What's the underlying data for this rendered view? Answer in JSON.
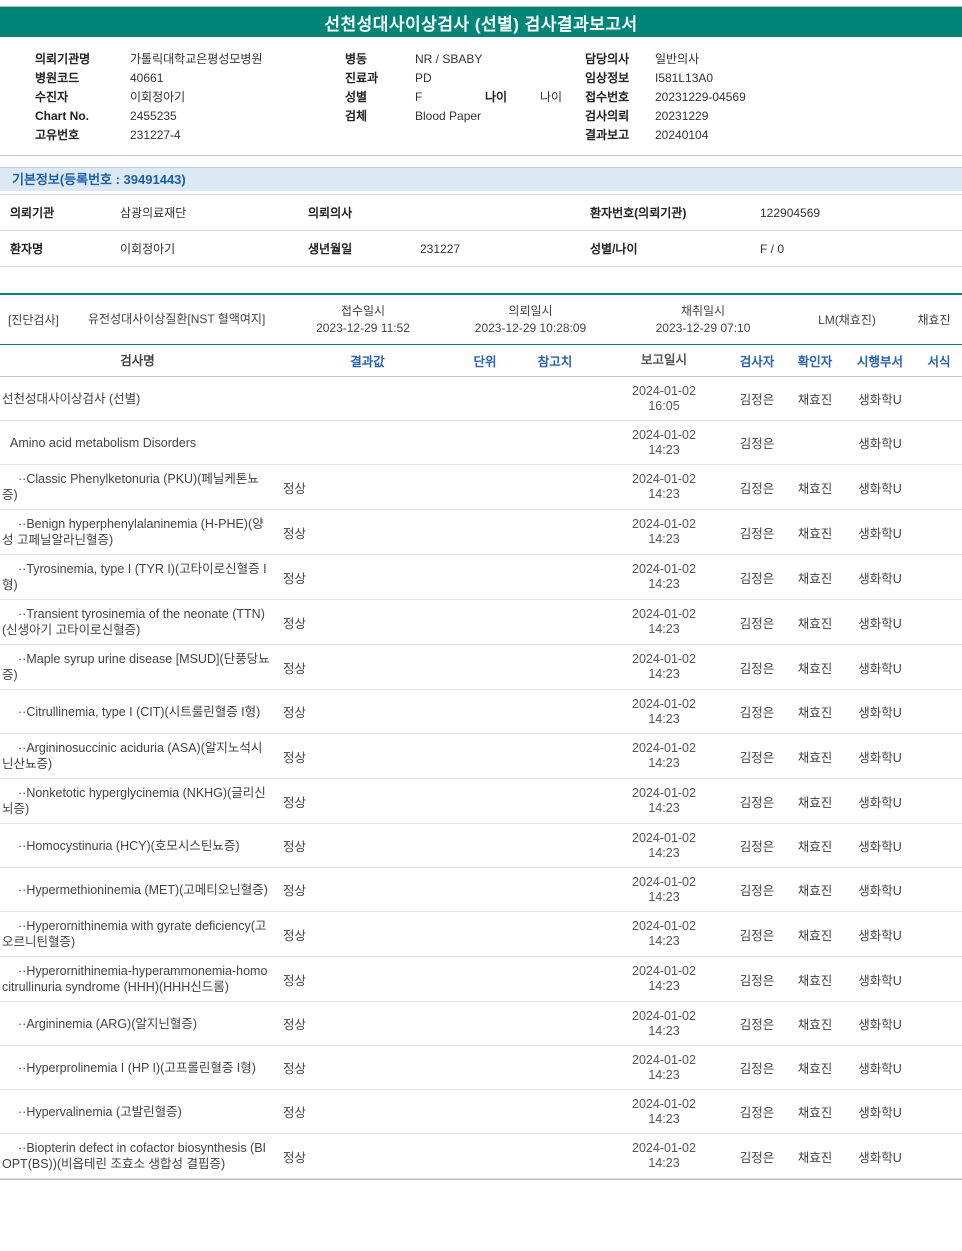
{
  "report": {
    "title": "선천성대사이상검사 (선별) 검사결과보고서"
  },
  "colors": {
    "accent_teal": "#008578",
    "section_bar_bg": "#dce9f5",
    "section_bar_text": "#1d5fa7",
    "table_header_text": "#2a63ae"
  },
  "patient_header": {
    "col1": [
      {
        "label": "의뢰기관명",
        "value": "가톨릭대학교은평성모병원"
      },
      {
        "label": "병원코드",
        "value": "40661"
      },
      {
        "label": "수진자",
        "value": "이회정아기"
      },
      {
        "label": "Chart No.",
        "value": "2455235"
      },
      {
        "label": "고유번호",
        "value": "231227-4"
      }
    ],
    "col2": [
      {
        "label": "병동",
        "value": "NR / SBABY"
      },
      {
        "label": "진료과",
        "value": "PD"
      },
      {
        "label": "성별",
        "value": "F",
        "extra_label": "나이",
        "extra_value": "나이"
      },
      {
        "label": "검체",
        "value": "Blood Paper"
      }
    ],
    "col3": [
      {
        "label": "담당의사",
        "value": "일반의사"
      },
      {
        "label": "임상정보",
        "value": "I581L13A0"
      },
      {
        "label": "접수번호",
        "value": "20231229-04569"
      },
      {
        "label": "검사의뢰",
        "value": "20231229"
      },
      {
        "label": "결과보고",
        "value": "20240104"
      }
    ]
  },
  "basic_info": {
    "title": "기본정보(등록번호 : 39491443)",
    "rows": [
      {
        "cells": [
          {
            "label": "의뢰기관",
            "value": "삼광의료재단"
          },
          {
            "label": "의뢰의사",
            "value": ""
          },
          {
            "label": "환자번호(의뢰기관)",
            "value": "122904569"
          }
        ]
      },
      {
        "cells": [
          {
            "label": "환자명",
            "value": "이회정아기"
          },
          {
            "label": "생년월일",
            "value": "231227"
          },
          {
            "label": "성별/나이",
            "value": "F / 0"
          }
        ]
      }
    ]
  },
  "order_info": {
    "category": "[진단검사]",
    "test_name": "유전성대사이상질환[NST 혈액여지]",
    "fields": [
      {
        "label": "접수일시",
        "value": "2023-12-29 11:52"
      },
      {
        "label": "의뢰일시",
        "value": "2023-12-29 10:28:09"
      },
      {
        "label": "채취일시",
        "value": "2023-12-29 07:10"
      }
    ],
    "collector": "LM(채효진)",
    "collector_name": "채효진"
  },
  "results": {
    "headers": {
      "name": "검사명",
      "result": "결과값",
      "unit": "단위",
      "ref": "참고치",
      "reported": "보고일시",
      "tester": "검사자",
      "confirmer": "확인자",
      "dept": "시행부서",
      "format": "서식"
    },
    "rows": [
      {
        "indent": 0,
        "name": "선천성대사이상검사 (선별)",
        "result": "",
        "unit": "",
        "ref": "",
        "reported": "2024-01-02 16:05",
        "tester": "김정은",
        "confirmer": "채효진",
        "dept": "생화학U"
      },
      {
        "indent": 1,
        "name": "Amino acid metabolism Disorders",
        "result": "",
        "unit": "",
        "ref": "",
        "reported": "2024-01-02 14:23",
        "tester": "김정은",
        "confirmer": "",
        "dept": "생화학U"
      },
      {
        "indent": 2,
        "name": "··Classic Phenylketonuria (PKU)(페닐케톤뇨증)",
        "result": "정상",
        "unit": "",
        "ref": "",
        "reported": "2024-01-02 14:23",
        "tester": "김정은",
        "confirmer": "채효진",
        "dept": "생화학U"
      },
      {
        "indent": 2,
        "name": "··Benign hyperphenylalaninemia (H-PHE)(양성 고페닐알라닌혈증)",
        "result": "정상",
        "unit": "",
        "ref": "",
        "reported": "2024-01-02 14:23",
        "tester": "김정은",
        "confirmer": "채효진",
        "dept": "생화학U"
      },
      {
        "indent": 2,
        "name": "··Tyrosinemia, type I (TYR I)(고타이로신혈증 I형)",
        "result": "정상",
        "unit": "",
        "ref": "",
        "reported": "2024-01-02 14:23",
        "tester": "김정은",
        "confirmer": "채효진",
        "dept": "생화학U"
      },
      {
        "indent": 2,
        "name": "··Transient tyrosinemia of the neonate (TTN)(신생아기 고타이로신혈증)",
        "result": "정상",
        "unit": "",
        "ref": "",
        "reported": "2024-01-02 14:23",
        "tester": "김정은",
        "confirmer": "채효진",
        "dept": "생화학U"
      },
      {
        "indent": 2,
        "name": "··Maple syrup urine disease [MSUD](단풍당뇨증)",
        "result": "정상",
        "unit": "",
        "ref": "",
        "reported": "2024-01-02 14:23",
        "tester": "김정은",
        "confirmer": "채효진",
        "dept": "생화학U"
      },
      {
        "indent": 2,
        "name": "··Citrullinemia, type I (CIT)(시트룰린혈증 I형)",
        "result": "정상",
        "unit": "",
        "ref": "",
        "reported": "2024-01-02 14:23",
        "tester": "김정은",
        "confirmer": "채효진",
        "dept": "생화학U"
      },
      {
        "indent": 2,
        "name": "··Argininosuccinic aciduria (ASA)(알지노석시닌산뇨증)",
        "result": "정상",
        "unit": "",
        "ref": "",
        "reported": "2024-01-02 14:23",
        "tester": "김정은",
        "confirmer": "채효진",
        "dept": "생화학U"
      },
      {
        "indent": 2,
        "name": "··Nonketotic hyperglycinemia (NKHG)(글리신뇌증)",
        "result": "정상",
        "unit": "",
        "ref": "",
        "reported": "2024-01-02 14:23",
        "tester": "김정은",
        "confirmer": "채효진",
        "dept": "생화학U"
      },
      {
        "indent": 2,
        "name": "··Homocystinuria (HCY)(호모시스틴뇨증)",
        "result": "정상",
        "unit": "",
        "ref": "",
        "reported": "2024-01-02 14:23",
        "tester": "김정은",
        "confirmer": "채효진",
        "dept": "생화학U"
      },
      {
        "indent": 2,
        "name": "··Hypermethioninemia (MET)(고메티오닌혈증)",
        "result": "정상",
        "unit": "",
        "ref": "",
        "reported": "2024-01-02 14:23",
        "tester": "김정은",
        "confirmer": "채효진",
        "dept": "생화학U"
      },
      {
        "indent": 2,
        "name": "··Hyperornithinemia with gyrate deficiency(고오르니틴혈증)",
        "result": "정상",
        "unit": "",
        "ref": "",
        "reported": "2024-01-02 14:23",
        "tester": "김정은",
        "confirmer": "채효진",
        "dept": "생화학U"
      },
      {
        "indent": 2,
        "name": "··Hyperornithinemia-hyperammonemia-homocitrullinuria syndrome (HHH)(HHH신드롬)",
        "result": "정상",
        "unit": "",
        "ref": "",
        "reported": "2024-01-02 14:23",
        "tester": "김정은",
        "confirmer": "채효진",
        "dept": "생화학U"
      },
      {
        "indent": 2,
        "name": "··Argininemia (ARG)(알지닌혈증)",
        "result": "정상",
        "unit": "",
        "ref": "",
        "reported": "2024-01-02 14:23",
        "tester": "김정은",
        "confirmer": "채효진",
        "dept": "생화학U"
      },
      {
        "indent": 2,
        "name": "··Hyperprolinemia I (HP I)(고프롤린혈증 I형)",
        "result": "정상",
        "unit": "",
        "ref": "",
        "reported": "2024-01-02 14:23",
        "tester": "김정은",
        "confirmer": "채효진",
        "dept": "생화학U"
      },
      {
        "indent": 2,
        "name": "··Hypervalinemia (고발린혈증)",
        "result": "정상",
        "unit": "",
        "ref": "",
        "reported": "2024-01-02 14:23",
        "tester": "김정은",
        "confirmer": "채효진",
        "dept": "생화학U"
      },
      {
        "indent": 2,
        "name": "··Biopterin defect in cofactor biosynthesis (BIOPT(BS))(비옵테린 조효소 생합성 결핍증)",
        "result": "정상",
        "unit": "",
        "ref": "",
        "reported": "2024-01-02 14:23",
        "tester": "김정은",
        "confirmer": "채효진",
        "dept": "생화학U"
      }
    ]
  }
}
